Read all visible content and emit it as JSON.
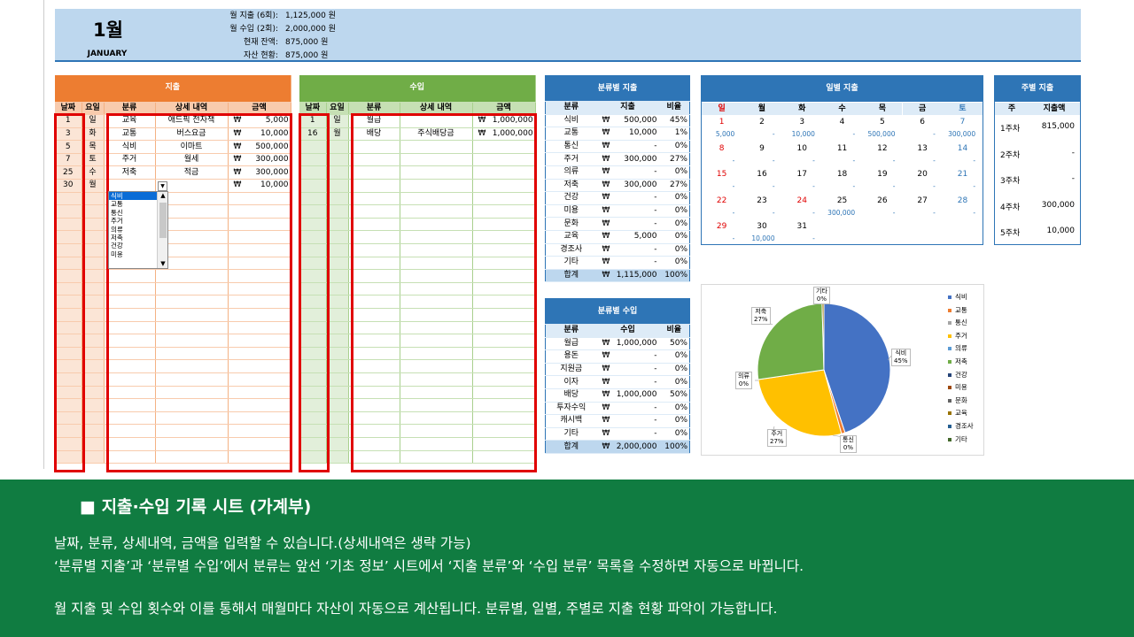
{
  "header": {
    "month": "1월",
    "month_en": "JANUARY",
    "summary": [
      {
        "label": "월 지출 (6회):",
        "value": "1,125,000 원"
      },
      {
        "label": "월 수입 (2회):",
        "value": "2,000,000 원"
      },
      {
        "label": "현재 잔액:",
        "value": "875,000 원"
      },
      {
        "label": "자산 현황:",
        "value": "875,000 원"
      }
    ]
  },
  "expense": {
    "title": "지출",
    "cols": [
      "날짜",
      "요일",
      "분류",
      "상세 내역",
      "금액"
    ],
    "rows": [
      [
        "1",
        "일",
        "교육",
        "애드픽 전자책",
        "₩",
        "5,000"
      ],
      [
        "3",
        "화",
        "교통",
        "버스요금",
        "₩",
        "10,000"
      ],
      [
        "5",
        "목",
        "식비",
        "이마트",
        "₩",
        "500,000"
      ],
      [
        "7",
        "토",
        "주거",
        "월세",
        "₩",
        "300,000"
      ],
      [
        "25",
        "수",
        "저축",
        "적금",
        "₩",
        "300,000"
      ],
      [
        "30",
        "월",
        "",
        "",
        "₩",
        "10,000"
      ]
    ]
  },
  "dropdown": {
    "options": [
      "식비",
      "교통",
      "통신",
      "주거",
      "의류",
      "저축",
      "건강",
      "미용"
    ],
    "selected": "식비"
  },
  "income": {
    "title": "수입",
    "cols": [
      "날짜",
      "요일",
      "분류",
      "상세 내역",
      "금액"
    ],
    "rows": [
      [
        "1",
        "일",
        "월급",
        "",
        "₩",
        "1,000,000"
      ],
      [
        "16",
        "월",
        "배당",
        "주식배당금",
        "₩",
        "1,000,000"
      ]
    ]
  },
  "cat_exp": {
    "title": "분류별 지출",
    "cols": [
      "분류",
      "지출",
      "비율"
    ],
    "rows": [
      [
        "식비",
        "₩",
        "500,000",
        "45%"
      ],
      [
        "교통",
        "₩",
        "10,000",
        "1%"
      ],
      [
        "통신",
        "₩",
        "-",
        "0%"
      ],
      [
        "주거",
        "₩",
        "300,000",
        "27%"
      ],
      [
        "의류",
        "₩",
        "-",
        "0%"
      ],
      [
        "저축",
        "₩",
        "300,000",
        "27%"
      ],
      [
        "건강",
        "₩",
        "-",
        "0%"
      ],
      [
        "미용",
        "₩",
        "-",
        "0%"
      ],
      [
        "문화",
        "₩",
        "-",
        "0%"
      ],
      [
        "교육",
        "₩",
        "5,000",
        "0%"
      ],
      [
        "경조사",
        "₩",
        "-",
        "0%"
      ],
      [
        "기타",
        "₩",
        "-",
        "0%"
      ]
    ],
    "total": [
      "합계",
      "₩",
      "1,115,000",
      "100%"
    ]
  },
  "cat_inc": {
    "title": "분류별 수입",
    "cols": [
      "분류",
      "수입",
      "비율"
    ],
    "rows": [
      [
        "월급",
        "₩",
        "1,000,000",
        "50%"
      ],
      [
        "용돈",
        "₩",
        "-",
        "0%"
      ],
      [
        "지원금",
        "₩",
        "-",
        "0%"
      ],
      [
        "이자",
        "₩",
        "-",
        "0%"
      ],
      [
        "배당",
        "₩",
        "1,000,000",
        "50%"
      ],
      [
        "투자수익",
        "₩",
        "-",
        "0%"
      ],
      [
        "캐시백",
        "₩",
        "-",
        "0%"
      ],
      [
        "기타",
        "₩",
        "-",
        "0%"
      ]
    ],
    "total": [
      "합계",
      "₩",
      "2,000,000",
      "100%"
    ]
  },
  "daily": {
    "title": "일별 지출",
    "days": [
      "일",
      "월",
      "화",
      "수",
      "목",
      "금",
      "토"
    ],
    "weeks": [
      {
        "nums": [
          "1",
          "2",
          "3",
          "4",
          "5",
          "6",
          "7"
        ],
        "vals": [
          "5,000",
          "-",
          "10,000",
          "-",
          "500,000",
          "-",
          "300,000"
        ]
      },
      {
        "nums": [
          "8",
          "9",
          "10",
          "11",
          "12",
          "13",
          "14"
        ],
        "vals": [
          "-",
          "-",
          "-",
          "-",
          "-",
          "-",
          "-"
        ]
      },
      {
        "nums": [
          "15",
          "16",
          "17",
          "18",
          "19",
          "20",
          "21"
        ],
        "vals": [
          "-",
          "-",
          "-",
          "-",
          "-",
          "-",
          "-"
        ]
      },
      {
        "nums": [
          "22",
          "23",
          "24",
          "25",
          "26",
          "27",
          "28"
        ],
        "vals": [
          "-",
          "-",
          "-",
          "300,000",
          "-",
          "-",
          "-"
        ]
      },
      {
        "nums": [
          "29",
          "30",
          "31",
          "",
          "",
          "",
          ""
        ],
        "vals": [
          "-",
          "10,000",
          "-",
          "",
          "",
          "",
          ""
        ]
      }
    ]
  },
  "weekly": {
    "title": "주별 지출",
    "cols": [
      "주",
      "지출액"
    ],
    "rows": [
      [
        "1주차",
        "815,000"
      ],
      [
        "2주차",
        "-"
      ],
      [
        "3주차",
        "-"
      ],
      [
        "4주차",
        "300,000"
      ],
      [
        "5주차",
        "10,000"
      ]
    ]
  },
  "chart_data": {
    "type": "pie",
    "categories": [
      "식비",
      "교통",
      "통신",
      "주거",
      "의류",
      "저축",
      "건강",
      "미용",
      "문화",
      "교육",
      "경조사",
      "기타"
    ],
    "values": [
      500000,
      10000,
      0,
      300000,
      0,
      300000,
      0,
      0,
      0,
      5000,
      0,
      0
    ],
    "labels": [
      {
        "name": "기타",
        "pct": "0%"
      },
      {
        "name": "저축",
        "pct": "27%"
      },
      {
        "name": "의류",
        "pct": "0%"
      },
      {
        "name": "주거",
        "pct": "27%"
      },
      {
        "name": "통신",
        "pct": "0%"
      },
      {
        "name": "식비",
        "pct": "45%"
      }
    ],
    "colors": [
      "#4472c4",
      "#ed7d31",
      "#a5a5a5",
      "#ffc000",
      "#5b9bd5",
      "#70ad47",
      "#264478",
      "#9e480e",
      "#636363",
      "#997300",
      "#255e91",
      "#43682b"
    ],
    "legend": "right"
  },
  "footer": {
    "heading": "■ 지출·수입 기록 시트 (가계부)",
    "lines": [
      "날짜, 분류, 상세내역, 금액을 입력할 수 있습니다.(상세내역은 생략 가능)",
      "‘분류별 지출’과 ‘분류별 수입’에서 분류는 앞선 ‘기초 정보’ 시트에서 ‘지출 분류’와 ‘수입 분류’ 목록을 수정하면 자동으로 바뀝니다.",
      "월 지출 및 수입 횟수와 이를 통해서  매월마다 자산이 자동으로 계산됩니다. 분류별, 일별, 주별로 지출 현황 파악이 가능합니다."
    ]
  }
}
